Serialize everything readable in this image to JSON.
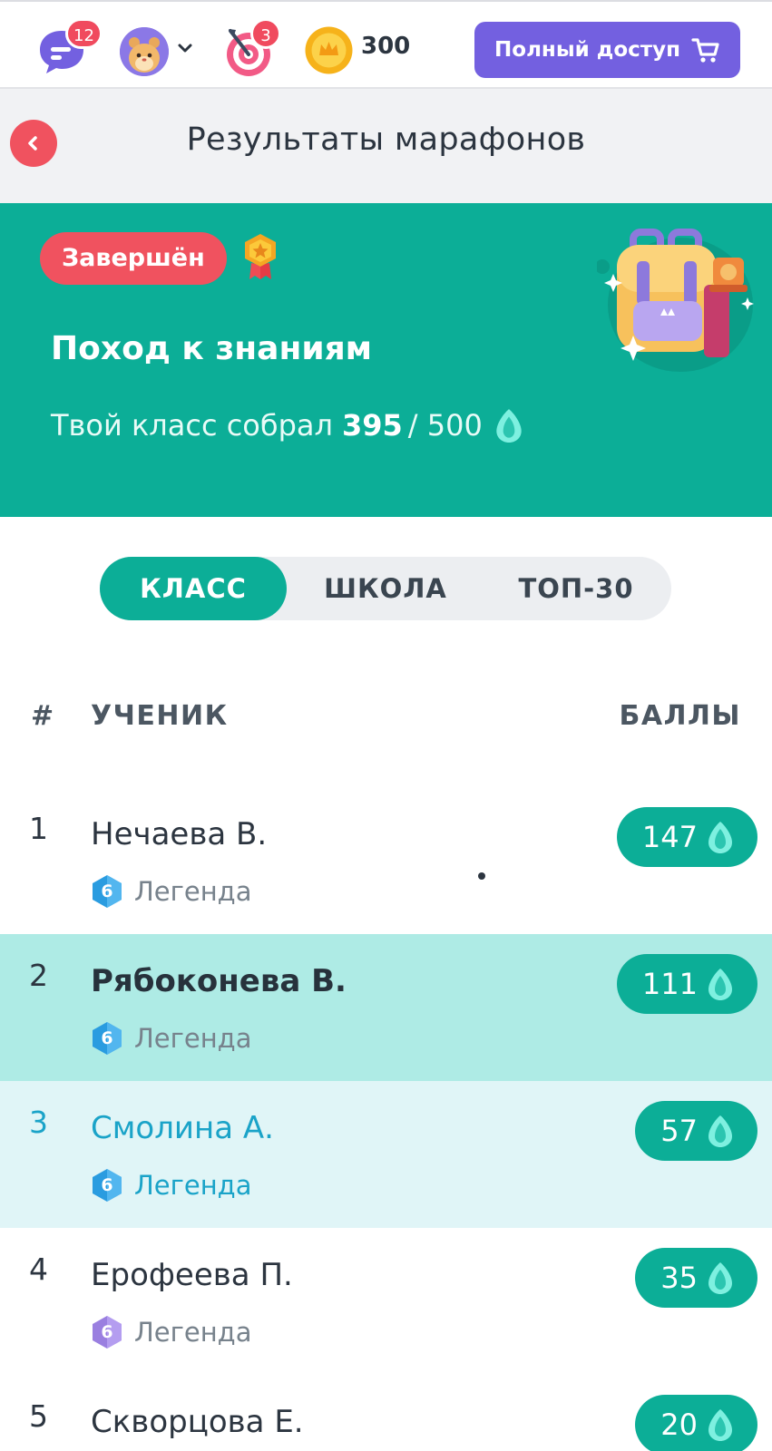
{
  "header": {
    "chat_badge": "12",
    "target_badge": "3",
    "coins": "300",
    "full_access_label": "Полный доступ"
  },
  "page": {
    "title": "Результаты марафонов"
  },
  "marathon": {
    "status": "Завершён",
    "title": "Поход к знаниям",
    "collected_prefix": "Твой класс собрал",
    "collected": "395",
    "separator_total": "/ 500"
  },
  "tabs": [
    {
      "label": "КЛАСС",
      "active": true
    },
    {
      "label": "ШКОЛА",
      "active": false
    },
    {
      "label": "ТОП-30",
      "active": false
    }
  ],
  "table": {
    "col_num": "#",
    "col_student": "УЧЕНИК",
    "col_score": "БАЛЛЫ",
    "rows": [
      {
        "rank": "1",
        "name": "Нечаева В.",
        "level": "6",
        "level_name": "Легенда",
        "score": "147"
      },
      {
        "rank": "2",
        "name": "Рябоконева В.",
        "level": "6",
        "level_name": "Легенда",
        "score": "111"
      },
      {
        "rank": "3",
        "name": "Смолина А.",
        "level": "6",
        "level_name": "Легенда",
        "score": "57"
      },
      {
        "rank": "4",
        "name": "Ерофеева П.",
        "level": "6",
        "level_name": "Легенда",
        "score": "35"
      },
      {
        "rank": "5",
        "name": "Скворцова Е.",
        "level": "6",
        "level_name": "Легенда",
        "score": "20"
      }
    ]
  },
  "colors": {
    "brand_green": "#0cae97",
    "accent_red": "#f0525f",
    "accent_purple": "#7360e0",
    "highlight_row": "#aeebe5",
    "current_user_row": "#e0f5f7"
  },
  "icons": [
    "chat-icon",
    "avatar",
    "chevron-down-icon",
    "target-icon",
    "coin-icon",
    "cart-icon",
    "back-icon",
    "medal-icon",
    "drop-icon",
    "backpack-illustration",
    "level-hex-icon"
  ]
}
